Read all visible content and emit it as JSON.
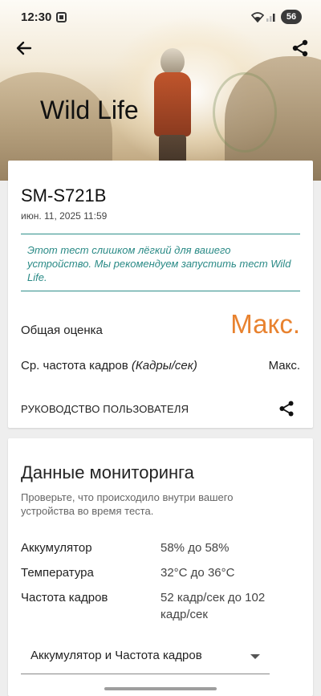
{
  "status_bar": {
    "time": "12:30",
    "battery_level": "56"
  },
  "header": {
    "title": "Wild Life",
    "back_icon": "arrow-left-icon",
    "share_icon": "share-icon"
  },
  "result": {
    "device_name": "SM-S721B",
    "date": "июн. 11, 2025 11:59",
    "notice": "Этот тест слишком лёгкий для вашего устройство. Мы рекомендуем запустить тест Wild Life.",
    "overall_label": "Общая оценка",
    "overall_value": "Макс.",
    "fps_label": "Ср. частота кадров",
    "fps_unit": "(Кадры/сек)",
    "fps_value": "Макс.",
    "guide_link": "РУКОВОДСТВО ПОЛЬЗОВАТЕЛЯ"
  },
  "monitoring": {
    "title": "Данные мониторинга",
    "description": "Проверьте, что происходило внутри вашего устройства во время теста.",
    "rows": [
      {
        "label": "Аккумулятор",
        "value": "58% до 58%"
      },
      {
        "label": "Температура",
        "value": "32°C до 36°C"
      },
      {
        "label": "Частота кадров",
        "value": "52 кадр/сек до 102 кадр/сек"
      }
    ],
    "select_value": "Аккумулятор и Частота кадров"
  },
  "colors": {
    "accent_orange": "#e8822f",
    "notice_teal": "#2a8a86"
  }
}
